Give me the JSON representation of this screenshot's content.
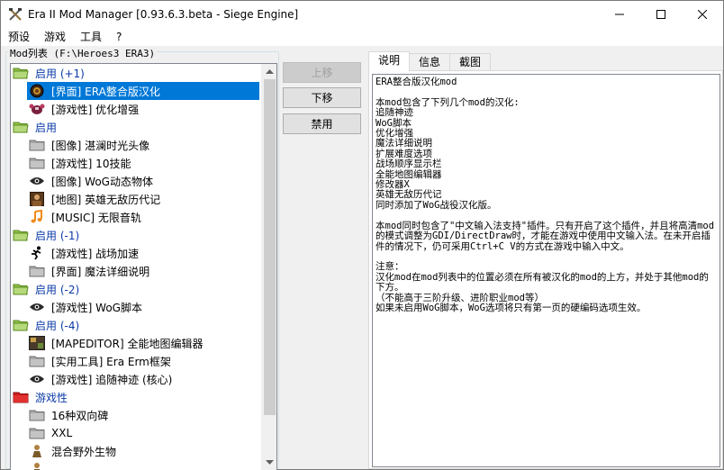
{
  "window": {
    "title": "Era II Mod Manager [0.93.6.3.beta - Siege Engine]"
  },
  "menu": [
    "预设",
    "游戏",
    "工具",
    "?"
  ],
  "mod_list": {
    "legend": "Mod列表 (F:\\Heroes3 ERA3)",
    "rows": [
      {
        "kind": "group",
        "label": "启用 (+1)",
        "icon": "folder-open-green-icon"
      },
      {
        "kind": "item",
        "label": "[界面] ERA整合版汉化",
        "icon": "emblem-icon",
        "selected": true
      },
      {
        "kind": "item",
        "label": "[游戏性] 优化增强",
        "icon": "crab-icon"
      },
      {
        "kind": "group",
        "label": "启用",
        "icon": "folder-open-green-icon"
      },
      {
        "kind": "item",
        "label": "[图像] 湛澜时光头像",
        "icon": "folder-gray-icon"
      },
      {
        "kind": "item",
        "label": "[游戏性] 10技能",
        "icon": "folder-gray-icon"
      },
      {
        "kind": "item",
        "label": "[图像] WoG动态物体",
        "icon": "eye-icon"
      },
      {
        "kind": "item",
        "label": "[地图] 英雄无敌历代记",
        "icon": "portrait-icon"
      },
      {
        "kind": "item",
        "label": "[MUSIC] 无限音轨",
        "icon": "music-note-icon"
      },
      {
        "kind": "group",
        "label": "启用 (-1)",
        "icon": "folder-open-green-icon"
      },
      {
        "kind": "item",
        "label": "[游戏性] 战场加速",
        "icon": "runner-icon"
      },
      {
        "kind": "item",
        "label": "[界面] 魔法详细说明",
        "icon": "folder-gray-icon"
      },
      {
        "kind": "group",
        "label": "启用 (-2)",
        "icon": "folder-open-green-icon"
      },
      {
        "kind": "item",
        "label": "[游戏性] WoG脚本",
        "icon": "eye-icon"
      },
      {
        "kind": "group",
        "label": "启用 (-4)",
        "icon": "folder-open-green-icon"
      },
      {
        "kind": "item",
        "label": "[MAPEDITOR] 全能地图编辑器",
        "icon": "map-editor-icon"
      },
      {
        "kind": "item",
        "label": "[实用工具] Era Erm框架",
        "icon": "folder-gray-icon"
      },
      {
        "kind": "item",
        "label": "[游戏性] 追随神迹 (核心)",
        "icon": "eye-icon"
      },
      {
        "kind": "group",
        "label": "游戏性",
        "icon": "folder-red-icon"
      },
      {
        "kind": "item",
        "label": "16种双向碑",
        "icon": "folder-gray-icon"
      },
      {
        "kind": "item",
        "label": "XXL",
        "icon": "folder-gray-icon"
      },
      {
        "kind": "item",
        "label": "混合野外生物",
        "icon": "creature-icon"
      },
      {
        "kind": "item",
        "label": "",
        "icon": "creature-icon"
      }
    ]
  },
  "buttons": {
    "move_up": "上移",
    "move_down": "下移",
    "disable": "禁用"
  },
  "tabs": [
    "说明",
    "信息",
    "截图"
  ],
  "description": "ERA整合版汉化mod\n\n本mod包含了下列几个mod的汉化:\n追随神迹\nWoG脚本\n优化增强\n魔法详细说明\n扩展难度选项\n战场顺序显示栏\n全能地图编辑器\n修改器X\n英雄无敌历代记\n同时添加了WoG战役汉化版。\n\n本mod同时包含了\"中文输入法支持\"插件。只有开启了这个插件，并且将高清mod的模式调整为GDI/DirectDraw时，才能在游戏中使用中文输入法。在未开启插件的情况下，仍可采用Ctrl+C V的方式在游戏中输入中文。\n\n注意：\n汉化mod在mod列表中的位置必须在所有被汉化的mod的上方，并处于其他mod的下方。\n（不能高于三阶升级、进阶职业mod等）\n如果未启用WoG脚本，WoG选项将只有第一页的硬编码选项生效。"
}
